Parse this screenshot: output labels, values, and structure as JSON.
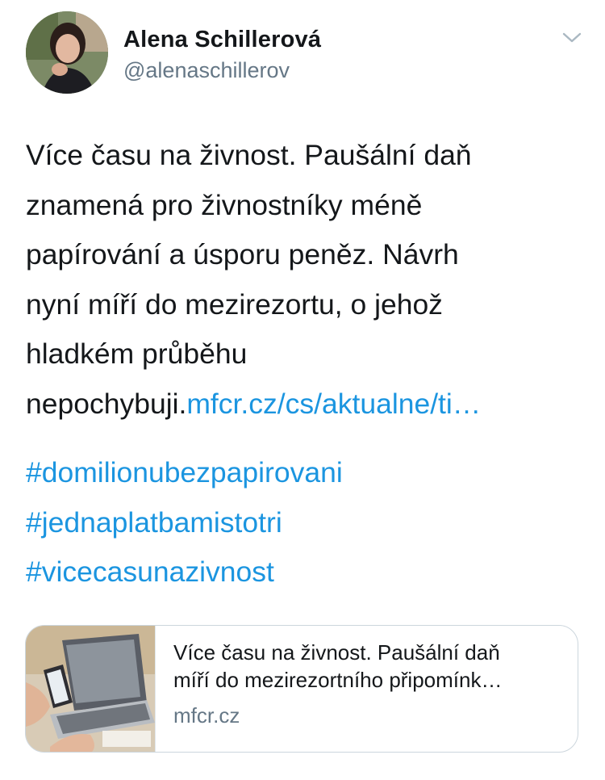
{
  "author": {
    "display_name": "Alena Schillerová",
    "handle": "@alenaschillerov",
    "avatar_icon": "profile-photo"
  },
  "menu": {
    "icon": "chevron-down-icon"
  },
  "tweet": {
    "lines": [
      "Více času na živnost. Paušální daň",
      "znamená pro živnostníky méně",
      "papírování a úsporu peněz. Návrh",
      "nyní míří do mezirezortu, o jehož",
      "hladkém průběhu"
    ],
    "last_line_text": "nepochybuji.",
    "link_text": "mfcr.cz/cs/aktualne/ti…",
    "hashtags": [
      "#domilionubezpapirovani",
      "#jednaplatbamistotri",
      "#vicecasunazivnost"
    ]
  },
  "card": {
    "title": "Více času na živnost. Paušální daň\nmíří do mezirezortního připomínk…",
    "domain": "mfcr.cz",
    "image_icon": "laptop-phone-photo"
  },
  "colors": {
    "text": "#14171a",
    "secondary": "#657786",
    "link": "#1b95e0",
    "border": "#ccd6dd"
  }
}
